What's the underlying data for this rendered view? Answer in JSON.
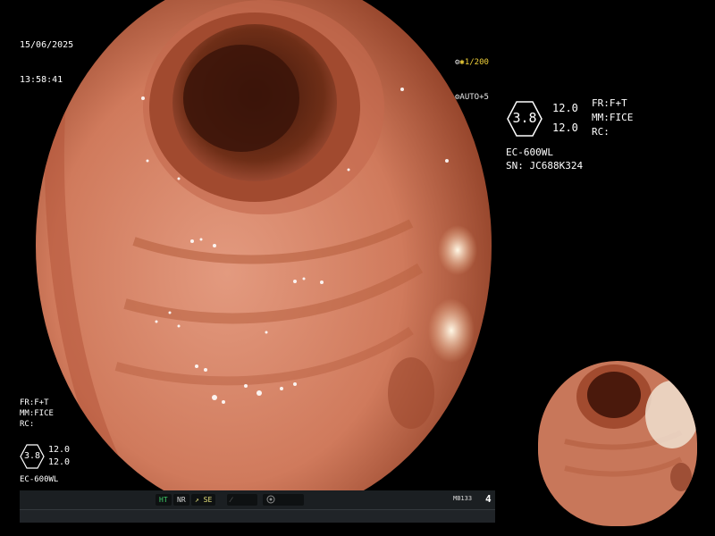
{
  "osd": {
    "date": "15/06/2025",
    "time": "13:58:41",
    "shutter": "1/200",
    "auto": "AUTO+5"
  },
  "info": {
    "hex_value": "3.8",
    "value_1": "12.0",
    "value_2": "12.0",
    "fr": "FR:F+T",
    "mm": "MM:FICE",
    "rc": "RC:",
    "model": "EC-600WL",
    "serial": "SN: JC688K324"
  },
  "info_small": {
    "fr": "FR:F+T",
    "mm": "MM:FICE",
    "rc": "RC:",
    "hex_value": "3.8",
    "value_1": "12.0",
    "value_2": "12.0",
    "model": "EC-600WL"
  },
  "status_bar": {
    "ht": "HT",
    "nr": "NR",
    "se": "SE",
    "code": "MB133",
    "count": "4"
  },
  "colors": {
    "tissue": "#d9826a",
    "lumen": "#3a1208",
    "shutter_icon": "#f2d23a",
    "ht_green": "#3ed06a"
  }
}
